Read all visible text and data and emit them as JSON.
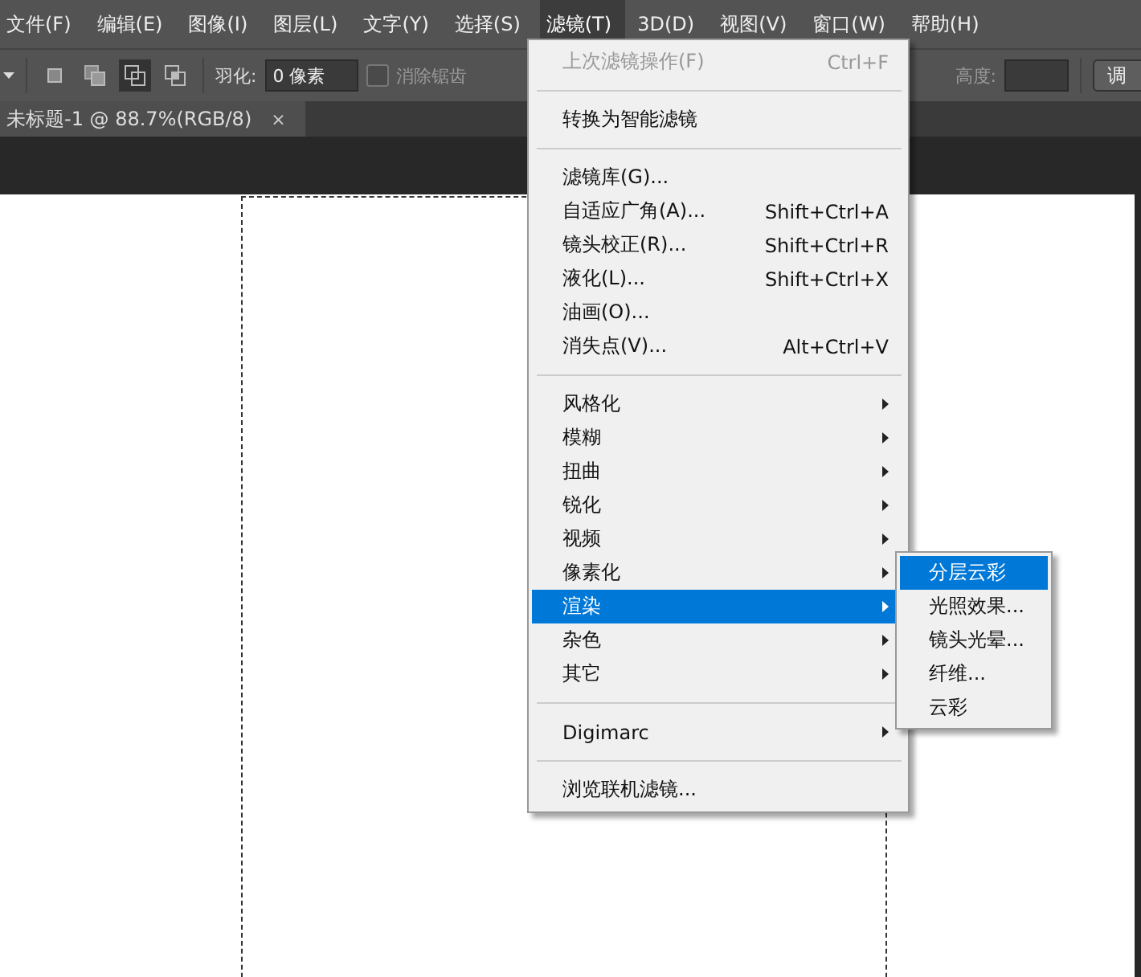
{
  "menubar": [
    {
      "label": "文件(F)",
      "selected": false
    },
    {
      "label": "编辑(E)",
      "selected": false
    },
    {
      "label": "图像(I)",
      "selected": false
    },
    {
      "label": "图层(L)",
      "selected": false
    },
    {
      "label": "文字(Y)",
      "selected": false
    },
    {
      "label": "选择(S)",
      "selected": false
    },
    {
      "label": "滤镜(T)",
      "selected": true
    },
    {
      "label": "3D(D)",
      "selected": false
    },
    {
      "label": "视图(V)",
      "selected": false
    },
    {
      "label": "窗口(W)",
      "selected": false
    },
    {
      "label": "帮助(H)",
      "selected": false
    }
  ],
  "options_bar": {
    "modes": [
      {
        "selected": false
      },
      {
        "selected": false
      },
      {
        "selected": true
      },
      {
        "selected": false
      }
    ],
    "feather_label": "羽化:",
    "feather_value": "0 像素",
    "antialias": {
      "label": "消除锯齿",
      "checked": false,
      "disabled": true
    },
    "height_label": "高度:",
    "adjust_button": "调"
  },
  "document_tab": {
    "title": "未标题-1 @ 88.7%(RGB/8)",
    "close": "×"
  },
  "filter_menu": [
    {
      "kind": "item",
      "label": "上次滤镜操作(F)",
      "shortcut": "Ctrl+F",
      "disabled": true,
      "selected": false
    },
    {
      "kind": "separator"
    },
    {
      "kind": "item",
      "label": "转换为智能滤镜",
      "disabled": false,
      "selected": false
    },
    {
      "kind": "separator"
    },
    {
      "kind": "item",
      "label": "滤镜库(G)...",
      "disabled": false,
      "selected": false
    },
    {
      "kind": "item",
      "label": "自适应广角(A)...",
      "shortcut": "Shift+Ctrl+A",
      "disabled": false,
      "selected": false
    },
    {
      "kind": "item",
      "label": "镜头校正(R)...",
      "shortcut": "Shift+Ctrl+R",
      "disabled": false,
      "selected": false
    },
    {
      "kind": "item",
      "label": "液化(L)...",
      "shortcut": "Shift+Ctrl+X",
      "disabled": false,
      "selected": false
    },
    {
      "kind": "item",
      "label": "油画(O)...",
      "disabled": false,
      "selected": false
    },
    {
      "kind": "item",
      "label": "消失点(V)...",
      "shortcut": "Alt+Ctrl+V",
      "disabled": false,
      "selected": false
    },
    {
      "kind": "separator"
    },
    {
      "kind": "submenu",
      "label": "风格化",
      "disabled": false,
      "selected": false
    },
    {
      "kind": "submenu",
      "label": "模糊",
      "disabled": false,
      "selected": false
    },
    {
      "kind": "submenu",
      "label": "扭曲",
      "disabled": false,
      "selected": false
    },
    {
      "kind": "submenu",
      "label": "锐化",
      "disabled": false,
      "selected": false
    },
    {
      "kind": "submenu",
      "label": "视频",
      "disabled": false,
      "selected": false
    },
    {
      "kind": "submenu",
      "label": "像素化",
      "disabled": false,
      "selected": false
    },
    {
      "kind": "submenu",
      "label": "渲染",
      "disabled": false,
      "selected": true
    },
    {
      "kind": "submenu",
      "label": "杂色",
      "disabled": false,
      "selected": false
    },
    {
      "kind": "submenu",
      "label": "其它",
      "disabled": false,
      "selected": false
    },
    {
      "kind": "separator"
    },
    {
      "kind": "submenu",
      "label": "Digimarc",
      "disabled": false,
      "selected": false
    },
    {
      "kind": "separator"
    },
    {
      "kind": "item",
      "label": "浏览联机滤镜...",
      "disabled": false,
      "selected": false
    }
  ],
  "render_submenu": [
    {
      "label": "分层云彩",
      "selected": true
    },
    {
      "label": "光照效果...",
      "selected": false
    },
    {
      "label": "镜头光晕...",
      "selected": false
    },
    {
      "label": "纤维...",
      "selected": false
    },
    {
      "label": "云彩",
      "selected": false
    }
  ]
}
